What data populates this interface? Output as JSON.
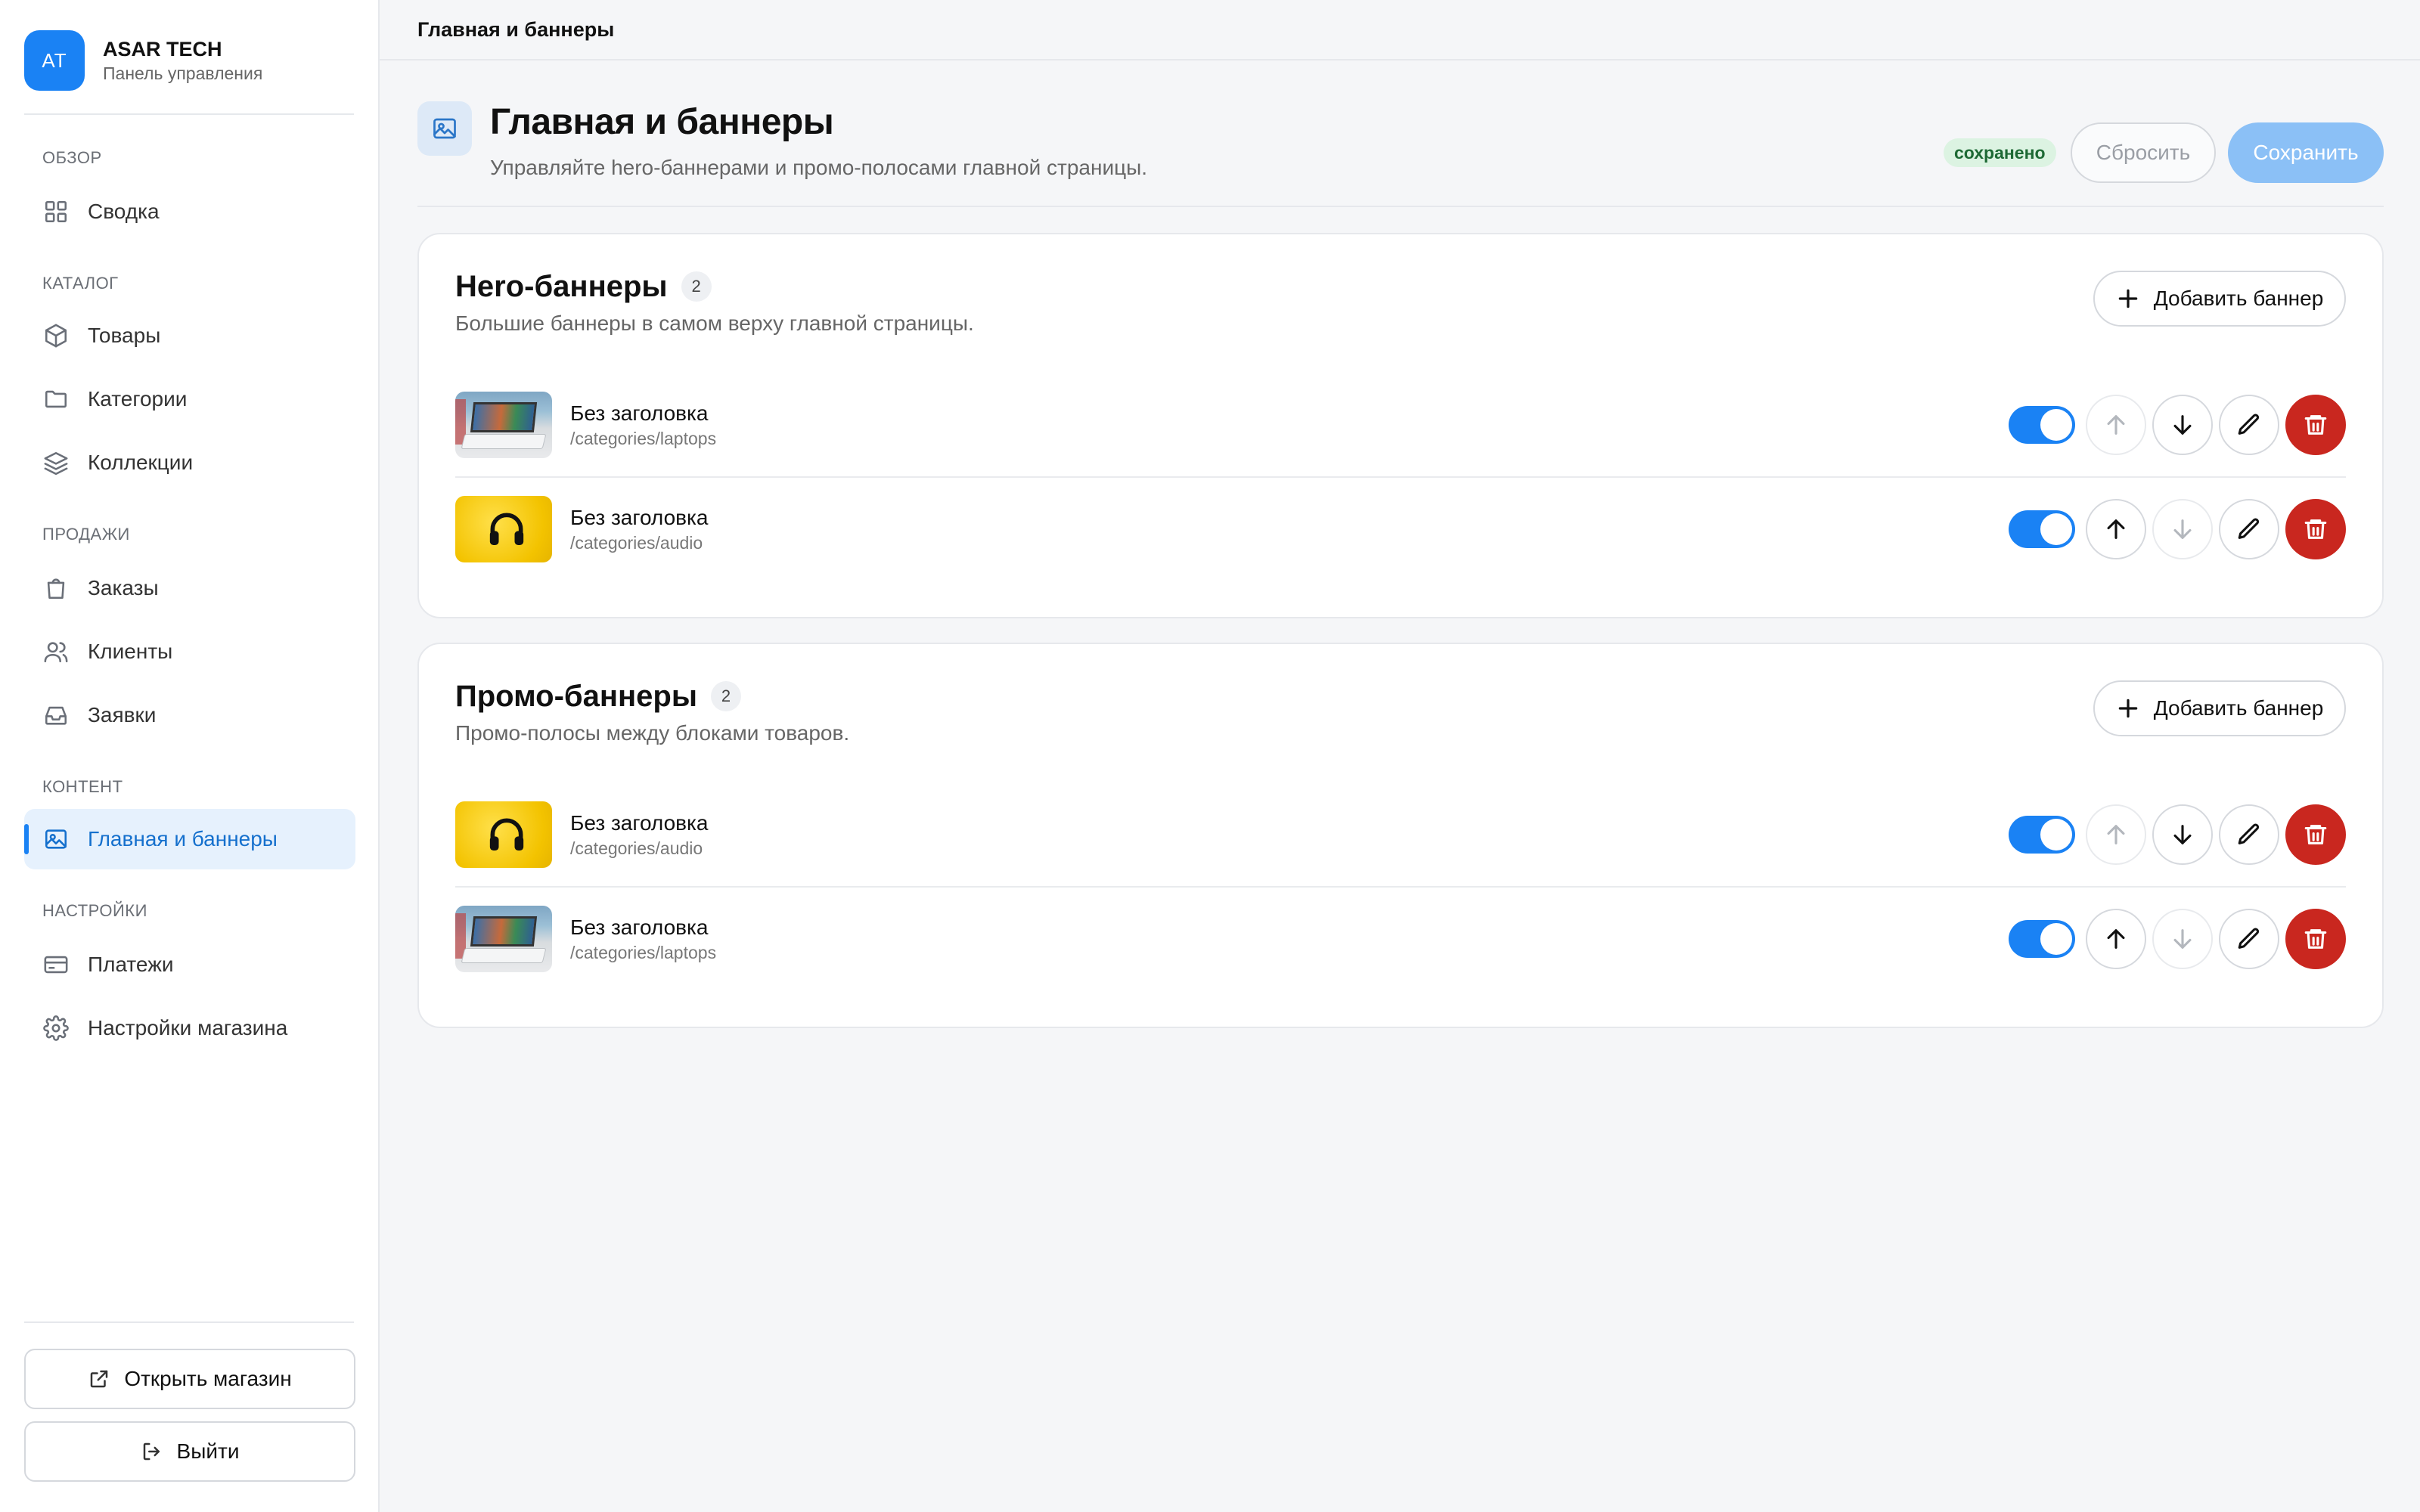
{
  "brand": {
    "initials": "AT",
    "name": "ASAR TECH",
    "subtitle": "Панель управления"
  },
  "nav": {
    "sections": [
      {
        "title": "ОБЗОР",
        "items": [
          {
            "label": "Сводка",
            "icon": "grid-icon"
          }
        ]
      },
      {
        "title": "КАТАЛОГ",
        "items": [
          {
            "label": "Товары",
            "icon": "box-icon"
          },
          {
            "label": "Категории",
            "icon": "folder-icon"
          },
          {
            "label": "Коллекции",
            "icon": "layers-icon"
          }
        ]
      },
      {
        "title": "ПРОДАЖИ",
        "items": [
          {
            "label": "Заказы",
            "icon": "shopping-bag-icon"
          },
          {
            "label": "Клиенты",
            "icon": "users-icon"
          },
          {
            "label": "Заявки",
            "icon": "inbox-icon"
          }
        ]
      },
      {
        "title": "КОНТЕНТ",
        "items": [
          {
            "label": "Главная и баннеры",
            "icon": "image-icon",
            "active": true
          }
        ]
      },
      {
        "title": "НАСТРОЙКИ",
        "items": [
          {
            "label": "Платежи",
            "icon": "credit-card-icon"
          },
          {
            "label": "Настройки магазина",
            "icon": "gear-icon"
          }
        ]
      }
    ],
    "open_store": "Открыть магазин",
    "logout": "Выйти"
  },
  "topbar": {
    "breadcrumb": "Главная и баннеры"
  },
  "header": {
    "title": "Главная и баннеры",
    "subtitle": "Управляйте hero-баннерами и промо-полосами главной страницы.",
    "status": "сохранено",
    "reset_label": "Сбросить",
    "save_label": "Сохранить"
  },
  "hero": {
    "title": "Hero-баннеры",
    "count": "2",
    "subtitle": "Большие баннеры в самом верху главной страницы.",
    "add_label": "Добавить баннер",
    "items": [
      {
        "title": "Без заголовка",
        "url": "/categories/laptops",
        "thumb": "laptop",
        "enabled": true,
        "can_up": false,
        "can_down": true
      },
      {
        "title": "Без заголовка",
        "url": "/categories/audio",
        "thumb": "headphones",
        "enabled": true,
        "can_up": true,
        "can_down": false
      }
    ]
  },
  "promo": {
    "title": "Промо-баннеры",
    "count": "2",
    "subtitle": "Промо-полосы между блоками товаров.",
    "add_label": "Добавить баннер",
    "items": [
      {
        "title": "Без заголовка",
        "url": "/categories/audio",
        "thumb": "headphones",
        "enabled": true,
        "can_up": false,
        "can_down": true
      },
      {
        "title": "Без заголовка",
        "url": "/categories/laptops",
        "thumb": "laptop",
        "enabled": true,
        "can_up": true,
        "can_down": false
      }
    ]
  },
  "colors": {
    "accent": "#1a82f4",
    "danger": "#c9271f",
    "saved_bg": "#dcf3e2",
    "saved_text": "#1e6a35"
  }
}
